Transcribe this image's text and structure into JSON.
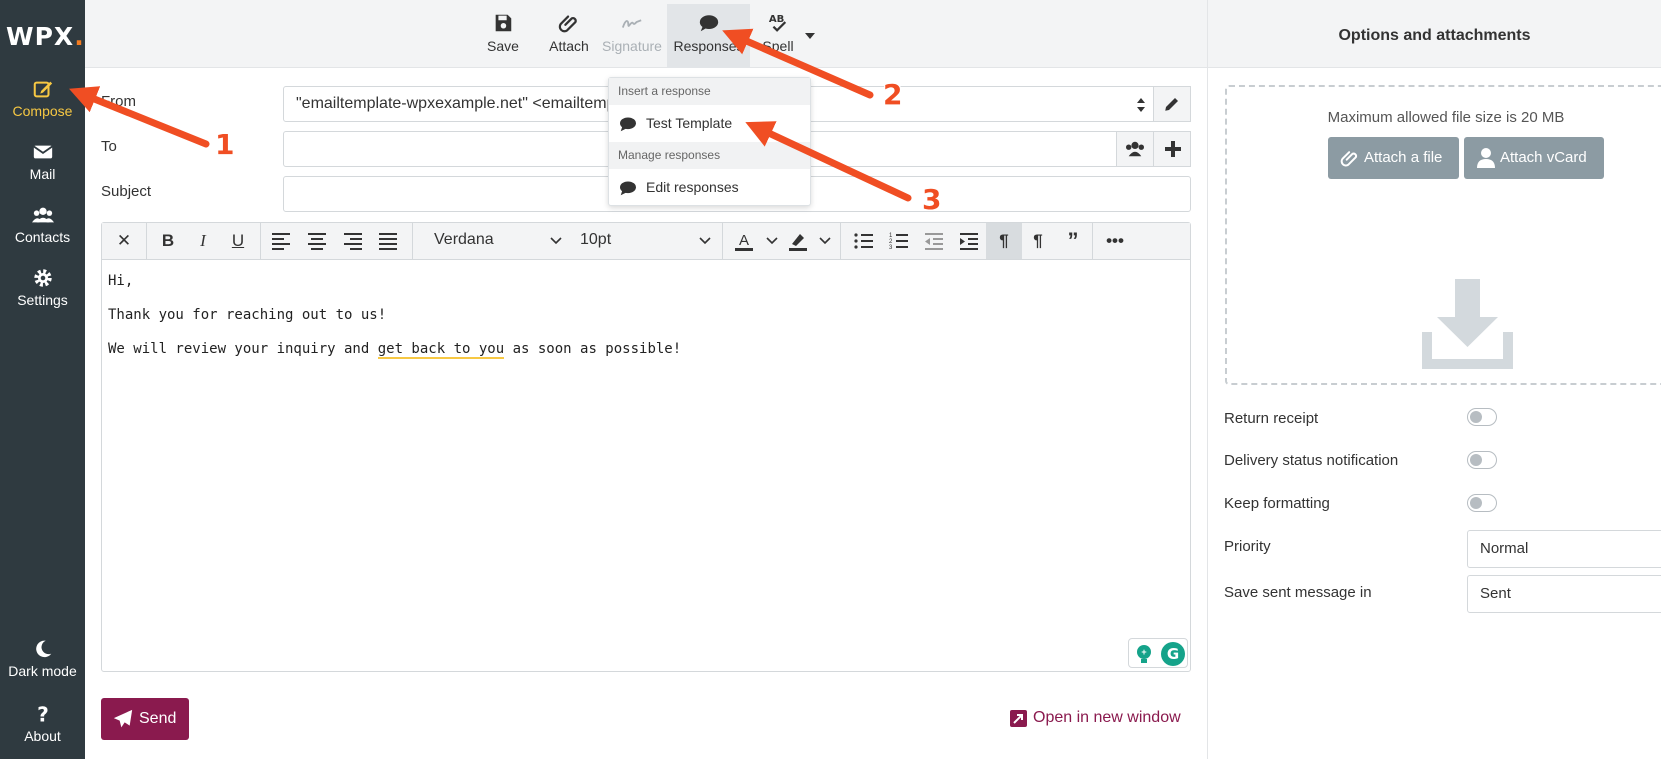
{
  "brand": {
    "logo": "WPX",
    "logo_dot": "."
  },
  "sidebar": {
    "items": [
      {
        "label": "Compose",
        "active": true
      },
      {
        "label": "Mail"
      },
      {
        "label": "Contacts"
      },
      {
        "label": "Settings"
      },
      {
        "label": "Dark mode"
      },
      {
        "label": "About"
      }
    ]
  },
  "toolbar": {
    "save": "Save",
    "attach": "Attach",
    "signature": "Signature",
    "responses": "Responses",
    "spell": "Spell"
  },
  "responses_menu": {
    "insert_header": "Insert a response",
    "items": [
      "Test Template"
    ],
    "manage_header": "Manage responses",
    "edit": "Edit responses"
  },
  "form": {
    "from_label": "From",
    "from_value": "\"emailtemplate-wpxexample.net\" <emailtemp",
    "to_label": "To",
    "to_value": "",
    "subject_label": "Subject",
    "subject_value": ""
  },
  "editor": {
    "font": "Verdana",
    "size": "10pt",
    "body": {
      "line1": "Hi,",
      "line2": "Thank you for reaching out to us!",
      "line3_a": "We will review your inquiry and ",
      "line3_b": "get back to you",
      "line3_c": " as soon as possible!"
    }
  },
  "actions": {
    "send": "Send",
    "open_new_window": "Open in new window"
  },
  "options": {
    "title": "Options and attachments",
    "max_size": "Maximum allowed file size is 20 MB",
    "attach_file": "Attach a file",
    "attach_vcard": "Attach vCard",
    "return_receipt": "Return receipt",
    "delivery_status": "Delivery status notification",
    "keep_formatting": "Keep formatting",
    "priority_label": "Priority",
    "priority_value": "Normal",
    "save_sent_label": "Save sent message in",
    "save_sent_value": "Sent"
  },
  "annotations": {
    "n1": "1",
    "n2": "2",
    "n3": "3"
  },
  "colors": {
    "sidebar": "#2f3a40",
    "accent": "#f7c843",
    "send": "#8a1a4e",
    "arrow": "#f04e23"
  }
}
